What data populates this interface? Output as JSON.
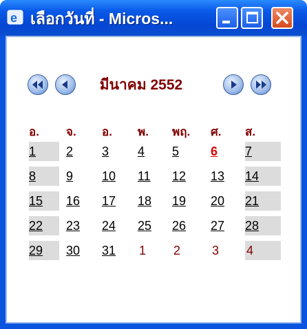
{
  "window": {
    "title": "เลือกวันที่ - Micros...",
    "controls": [
      "minimize",
      "maximize",
      "close"
    ]
  },
  "calendar": {
    "month_label": "มีนาคม 2552",
    "nav_icons": [
      "rewind-icon",
      "back-icon",
      "forward-icon",
      "fast-forward-icon"
    ],
    "weekdays": [
      "อ.",
      "จ.",
      "อ.",
      "พ.",
      "พฤ.",
      "ศ.",
      "ส."
    ],
    "weeks": [
      [
        "1",
        "2",
        "3",
        "4",
        "5",
        "6",
        "7"
      ],
      [
        "8",
        "9",
        "10",
        "11",
        "12",
        "13",
        "14"
      ],
      [
        "15",
        "16",
        "17",
        "18",
        "19",
        "20",
        "21"
      ],
      [
        "22",
        "23",
        "24",
        "25",
        "26",
        "27",
        "28"
      ],
      [
        "29",
        "30",
        "31",
        "1",
        "2",
        "3",
        "4"
      ]
    ],
    "today": "6",
    "next_month_days_start_week": 4,
    "next_month_days_start_col": 3
  },
  "colors": {
    "title_bar": "#0a54e0",
    "heading": "#800000",
    "weekend_bg": "#dcdcdc",
    "today": "#e00000"
  }
}
